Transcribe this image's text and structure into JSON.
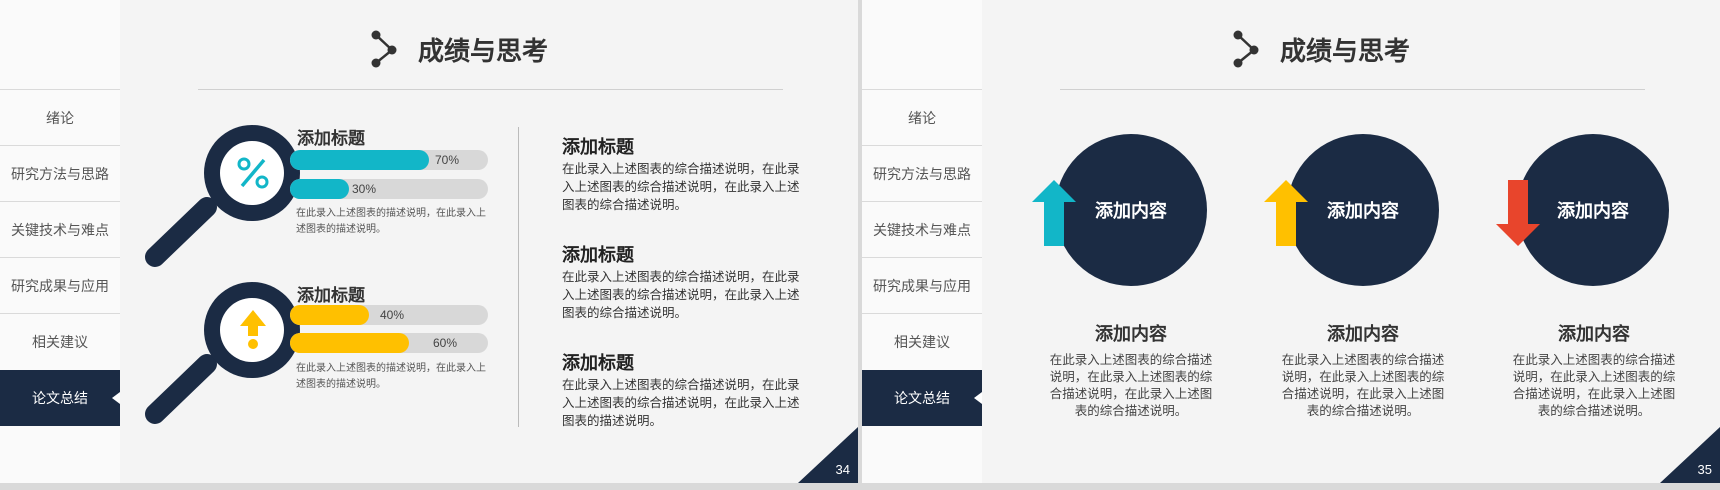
{
  "colors": {
    "navy": "#1b2b44",
    "cyan": "#12b6c8",
    "yellow": "#ffc000",
    "red": "#e8452c",
    "bar_bg": "#d8d8d8"
  },
  "sidebar": {
    "items": [
      {
        "label": "绪论"
      },
      {
        "label": "研究方法与思路"
      },
      {
        "label": "关键技术与难点"
      },
      {
        "label": "研究成果与应用"
      },
      {
        "label": "相关建议"
      },
      {
        "label": "论文总结",
        "active": true
      }
    ]
  },
  "slide34": {
    "title": "成绩与思考",
    "title_icon": "share-nodes-icon",
    "page": "34",
    "magnifiers": [
      {
        "title": "添加标题",
        "icon": "percent-icon",
        "color": "#12b6c8",
        "bars": [
          {
            "label": "70%",
            "value": 0.7
          },
          {
            "label": "30%",
            "value": 0.3
          }
        ],
        "desc": "在此录入上述图表的描述说明，在此录入上述图表的描述说明。"
      },
      {
        "title": "添加标题",
        "icon": "arrow-up-icon",
        "color": "#ffc000",
        "bars": [
          {
            "label": "40%",
            "value": 0.4
          },
          {
            "label": "60%",
            "value": 0.6
          }
        ],
        "desc": "在此录入上述图表的描述说明，在此录入上述图表的描述说明。"
      }
    ],
    "text_blocks": [
      {
        "title": "添加标题",
        "desc": "在此录入上述图表的综合描述说明，在此录入上述图表的综合描述说明，在此录入上述图表的综合描述说明。"
      },
      {
        "title": "添加标题",
        "desc": "在此录入上述图表的综合描述说明，在此录入上述图表的综合描述说明，在此录入上述图表的综合描述说明。"
      },
      {
        "title": "添加标题",
        "desc": "在此录入上述图表的综合描述说明，在此录入上述图表的综合描述说明，在此录入上述图表的描述说明。"
      }
    ]
  },
  "slide35": {
    "title": "成绩与思考",
    "title_icon": "share-nodes-icon",
    "page": "35",
    "columns": [
      {
        "circle_label": "添加内容",
        "arrow": "arrow-up-icon",
        "arrow_color": "#12b6c8",
        "title": "添加内容",
        "desc": "在此录入上述图表的综合描述说明，在此录入上述图表的综合描述说明，在此录入上述图表的综合描述说明。"
      },
      {
        "circle_label": "添加内容",
        "arrow": "arrow-up-icon",
        "arrow_color": "#ffc000",
        "title": "添加内容",
        "desc": "在此录入上述图表的综合描述说明，在此录入上述图表的综合描述说明，在此录入上述图表的综合描述说明。"
      },
      {
        "circle_label": "添加内容",
        "arrow": "arrow-down-icon",
        "arrow_color": "#e8452c",
        "title": "添加内容",
        "desc": "在此录入上述图表的综合描述说明，在此录入上述图表的综合描述说明，在此录入上述图表的综合描述说明。"
      }
    ]
  }
}
